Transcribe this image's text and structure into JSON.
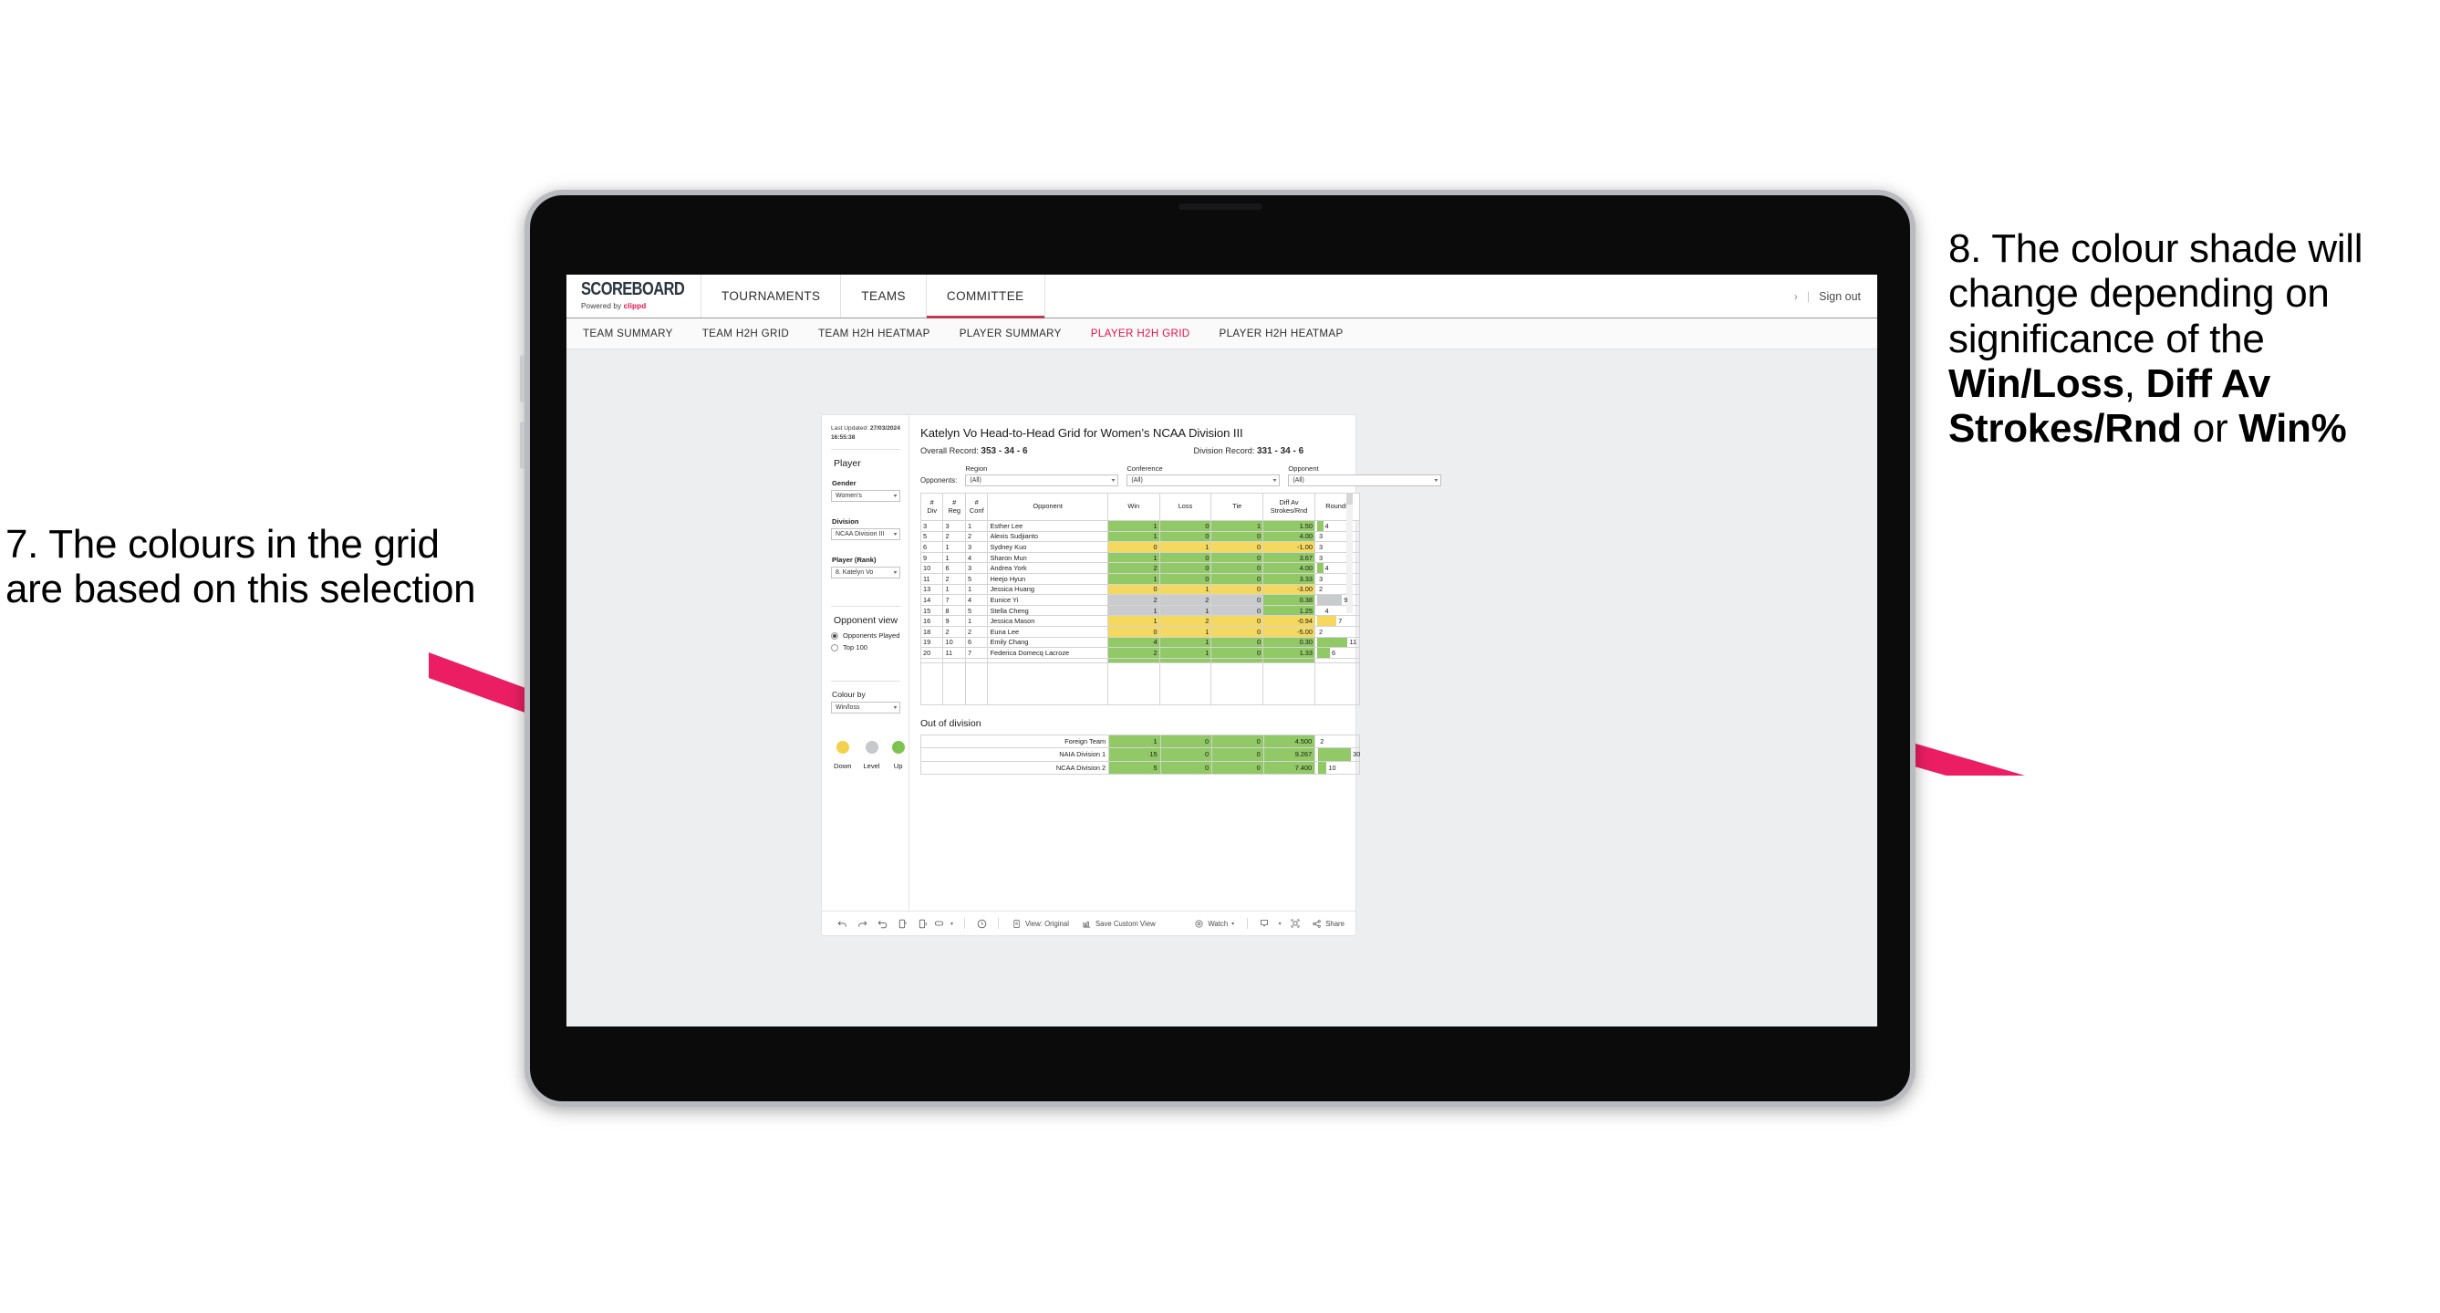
{
  "annotations": {
    "left": {
      "id": "7.",
      "text": "7. The colours in the grid are based on this selection"
    },
    "right": {
      "id": "8.",
      "part1": "8. The colour shade will change depending on significance of the ",
      "bold1": "Win/Loss",
      "sep1": ", ",
      "bold2": "Diff Av Strokes/Rnd",
      "sep2": " or ",
      "bold3": "Win%"
    },
    "arrow_color": "#ec1e63"
  },
  "app": {
    "brand": {
      "name": "SCOREBOARD",
      "powered_prefix": "Powered by ",
      "powered_brand": "clippd"
    },
    "topnav": [
      {
        "label": "TOURNAMENTS",
        "active": false
      },
      {
        "label": "TEAMS",
        "active": false
      },
      {
        "label": "COMMITTEE",
        "active": true
      }
    ],
    "topbar_right": {
      "chevron": "›",
      "divider": "|",
      "signout": "Sign out"
    },
    "subnav": [
      {
        "label": "TEAM SUMMARY",
        "active": false
      },
      {
        "label": "TEAM H2H GRID",
        "active": false
      },
      {
        "label": "TEAM H2H HEATMAP",
        "active": false
      },
      {
        "label": "PLAYER SUMMARY",
        "active": false
      },
      {
        "label": "PLAYER H2H GRID",
        "active": true
      },
      {
        "label": "PLAYER H2H HEATMAP",
        "active": false
      }
    ],
    "accent_color": "#e8114b"
  },
  "sidebar": {
    "last_updated_label": "Last Updated: ",
    "last_updated_value": "27/03/2024 16:55:38",
    "player_heading": "Player",
    "filters": [
      {
        "label": "Gender",
        "value": "Women’s"
      },
      {
        "label": "Division",
        "value": "NCAA Division III"
      },
      {
        "label": "Player (Rank)",
        "value": "8. Katelyn Vo"
      }
    ],
    "opponent_view": {
      "heading": "Opponent view",
      "options": [
        {
          "label": "Opponents Played",
          "selected": true
        },
        {
          "label": "Top 100",
          "selected": false
        }
      ]
    },
    "colour_by": {
      "label": "Colour by",
      "value": "Win/loss"
    },
    "legend": [
      {
        "label": "Down",
        "color": "#f3d14e"
      },
      {
        "label": "Level",
        "color": "#c6c8ca"
      },
      {
        "label": "Up",
        "color": "#7ec34f"
      }
    ]
  },
  "main": {
    "title": "Katelyn Vo Head-to-Head Grid for Women’s NCAA Division III",
    "overall_record_label": "Overall Record: ",
    "overall_record_value": "353 -  34 - 6",
    "division_record_label": "Division Record: ",
    "division_record_value": "331 -  34 - 6",
    "opponents_label": "Opponents:",
    "opponent_filters": [
      {
        "caption": "Region",
        "value": "(All)"
      },
      {
        "caption": "Conference",
        "value": "(All)"
      },
      {
        "caption": "Opponent",
        "value": "(All)"
      }
    ],
    "table": {
      "headers": [
        "#\nDiv",
        "#\nReg",
        "#\nConf",
        "Opponent",
        "Win",
        "Loss",
        "Tie",
        "Diff Av\nStrokes/Rnd",
        "Rounds"
      ],
      "header_lines": [
        [
          "#",
          "Div"
        ],
        [
          "#",
          "Reg"
        ],
        [
          "#",
          "Conf"
        ],
        [
          "Opponent"
        ],
        [
          "Win"
        ],
        [
          "Loss"
        ],
        [
          "Tie"
        ],
        [
          "Diff Av",
          "Strokes/Rnd"
        ],
        [
          "Rounds"
        ]
      ],
      "rows": [
        {
          "div": "3",
          "reg": "3",
          "conf": "1",
          "opponent": "Esther Lee",
          "win": "1",
          "loss": "0",
          "tie": "1",
          "diff": "1.50",
          "rounds": "4",
          "bg": "green",
          "rounds_bar_pct": 15,
          "rounds_bar": "green"
        },
        {
          "div": "5",
          "reg": "2",
          "conf": "2",
          "opponent": "Alexis Sudjianto",
          "win": "1",
          "loss": "0",
          "tie": "0",
          "diff": "4.00",
          "rounds": "3",
          "bg": "green",
          "rounds_bar_pct": 0,
          "rounds_bar": "green"
        },
        {
          "div": "6",
          "reg": "1",
          "conf": "3",
          "opponent": "Sydney Kuo",
          "win": "0",
          "loss": "1",
          "tie": "0",
          "diff": "-1.00",
          "rounds": "3",
          "bg": "yellow",
          "rounds_bar_pct": 0,
          "rounds_bar": "yellow"
        },
        {
          "div": "9",
          "reg": "1",
          "conf": "4",
          "opponent": "Sharon Mun",
          "win": "1",
          "loss": "0",
          "tie": "0",
          "diff": "3.67",
          "rounds": "3",
          "bg": "green",
          "rounds_bar_pct": 0,
          "rounds_bar": "green"
        },
        {
          "div": "10",
          "reg": "6",
          "conf": "3",
          "opponent": "Andrea York",
          "win": "2",
          "loss": "0",
          "tie": "0",
          "diff": "4.00",
          "rounds": "4",
          "bg": "green",
          "rounds_bar_pct": 15,
          "rounds_bar": "green"
        },
        {
          "div": "11",
          "reg": "2",
          "conf": "5",
          "opponent": "Heejo Hyun",
          "win": "1",
          "loss": "0",
          "tie": "0",
          "diff": "3.33",
          "rounds": "3",
          "bg": "green",
          "rounds_bar_pct": 0,
          "rounds_bar": "green"
        },
        {
          "div": "13",
          "reg": "1",
          "conf": "1",
          "opponent": "Jessica Huang",
          "win": "0",
          "loss": "1",
          "tie": "0",
          "diff": "-3.00",
          "rounds": "2",
          "bg": "yellow",
          "rounds_bar_pct": 0,
          "rounds_bar": "yellow"
        },
        {
          "div": "14",
          "reg": "7",
          "conf": "4",
          "opponent": "Eunice Yi",
          "win": "2",
          "loss": "2",
          "tie": "0",
          "diff": "0.38",
          "rounds": "9",
          "bg": "grey",
          "diff_bg": "green",
          "rounds_bar_pct": 62,
          "rounds_bar": "grey"
        },
        {
          "div": "15",
          "reg": "8",
          "conf": "5",
          "opponent": "Stella Cheng",
          "win": "1",
          "loss": "1",
          "tie": "0",
          "diff": "1.25",
          "rounds": "4",
          "bg": "grey",
          "diff_bg": "green",
          "rounds_bar_pct": 15,
          "rounds_bar": "white"
        },
        {
          "div": "16",
          "reg": "9",
          "conf": "1",
          "opponent": "Jessica Mason",
          "win": "1",
          "loss": "2",
          "tie": "0",
          "diff": "-0.94",
          "rounds": "7",
          "bg": "yellow",
          "rounds_bar_pct": 48,
          "rounds_bar": "yellow"
        },
        {
          "div": "18",
          "reg": "2",
          "conf": "2",
          "opponent": "Euna Lee",
          "win": "0",
          "loss": "1",
          "tie": "0",
          "diff": "-5.00",
          "rounds": "2",
          "bg": "yellow",
          "rounds_bar_pct": 0,
          "rounds_bar": "yellow"
        },
        {
          "div": "19",
          "reg": "10",
          "conf": "6",
          "opponent": "Emily Chang",
          "win": "4",
          "loss": "1",
          "tie": "0",
          "diff": "0.30",
          "rounds": "11",
          "bg": "green",
          "rounds_bar_pct": 76,
          "rounds_bar": "green"
        },
        {
          "div": "20",
          "reg": "11",
          "conf": "7",
          "opponent": "Federica Domecq Lacroze",
          "win": "2",
          "loss": "1",
          "tie": "0",
          "diff": "1.33",
          "rounds": "6",
          "bg": "green",
          "rounds_bar_pct": 32,
          "rounds_bar": "green"
        }
      ],
      "scrollbar_visible": true
    },
    "out_of_division": {
      "title": "Out of division",
      "rows": [
        {
          "name": "Foreign Team",
          "win": "1",
          "loss": "0",
          "tie": "0",
          "diff": "4.500",
          "rounds": "2",
          "bg": "green",
          "rounds_bar_pct": 0,
          "rounds_bar": "white"
        },
        {
          "name": "NAIA Division 1",
          "win": "15",
          "loss": "0",
          "tie": "0",
          "diff": "9.267",
          "rounds": "30",
          "bg": "green",
          "rounds_bar_pct": 86,
          "rounds_bar": "green"
        },
        {
          "name": "NCAA Division 2",
          "win": "5",
          "loss": "0",
          "tie": "0",
          "diff": "7.400",
          "rounds": "10",
          "bg": "green",
          "rounds_bar_pct": 22,
          "rounds_bar": "green"
        }
      ]
    },
    "colors": {
      "green": "#90c965",
      "yellow": "#f5d85f",
      "grey": "#c9cbcd"
    }
  },
  "footer": {
    "icons": [
      "undo-icon",
      "redo-icon",
      "revert-icon",
      "refresh-data-icon",
      "pause-icon",
      "layout-icon",
      "caret-down-icon",
      "clock-history-icon"
    ],
    "view_label": "View: Original",
    "save_label": "Save Custom View",
    "watch_label": "Watch",
    "share_label": "Share"
  }
}
